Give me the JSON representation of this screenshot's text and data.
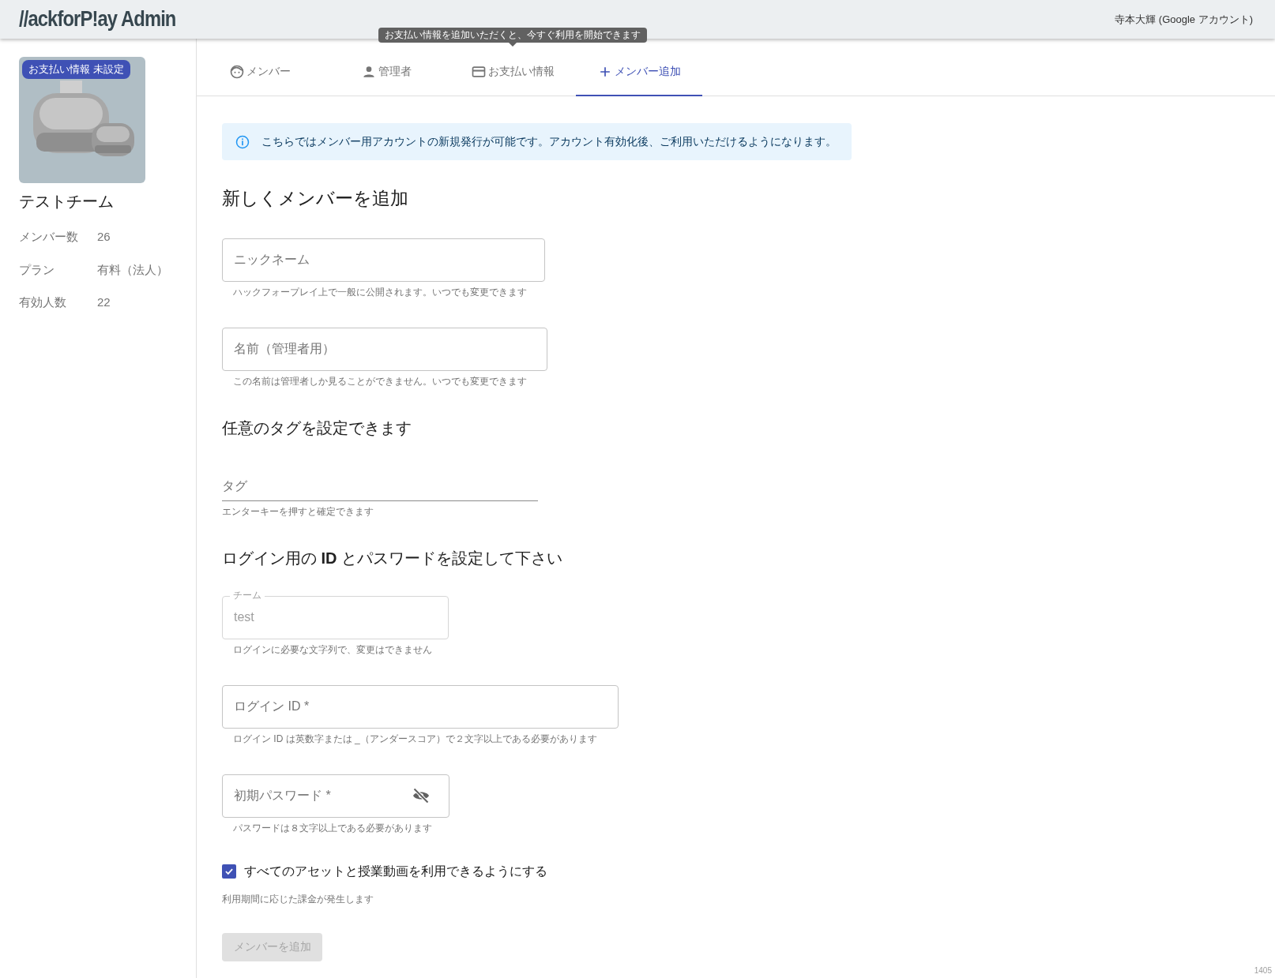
{
  "header": {
    "logo": "//ackforP!ay Admin",
    "account": "寺本大輝 (Google アカウント)"
  },
  "sidebar": {
    "badge": "お支払い情報 未設定",
    "team_name": "テストチーム",
    "stats": [
      {
        "label": "メンバー数",
        "value": "26"
      },
      {
        "label": "プラン",
        "value": "有料（法人）"
      },
      {
        "label": "有効人数",
        "value": "22"
      }
    ]
  },
  "tabs": [
    {
      "label": "メンバー",
      "selected": false
    },
    {
      "label": "管理者",
      "selected": false
    },
    {
      "label": "お支払い情報",
      "selected": false,
      "tooltip": "お支払い情報を追加いただくと、今すぐ利用を開始できます"
    },
    {
      "label": "メンバー追加",
      "selected": true
    }
  ],
  "alert": {
    "text": "こちらではメンバー用アカウントの新規発行が可能です。アカウント有効化後、ご利用いただけるようになります。"
  },
  "form": [
    {
      "kind": "heading",
      "text": "新しくメンバーを追加"
    },
    {
      "kind": "outlined",
      "placeholder": "ニックネーム",
      "helper": "ハックフォープレイ上で一般に公開されます。いつでも変更できます"
    },
    {
      "kind": "outlined",
      "placeholder": "名前（管理者用）",
      "helper": "この名前は管理者しか見ることができません。いつでも変更できます"
    },
    {
      "kind": "heading",
      "text": "任意のタグを設定できます"
    },
    {
      "kind": "underlined",
      "placeholder": "タグ",
      "helper": "エンターキーを押すと確定できます"
    },
    {
      "kind": "heading",
      "text": "ログイン用の **ID** とパスワードを設定して下さい"
    },
    {
      "kind": "outlined",
      "label": "チーム",
      "value": "test",
      "disabled": true,
      "helper": "ログインに必要な文字列で、変更はできません"
    },
    {
      "kind": "outlined",
      "placeholder": "ログイン ID *",
      "helper": "ログイン ID は英数字または _（アンダースコア）で２文字以上である必要があります"
    },
    {
      "kind": "outlined",
      "placeholder": "初期パスワード *",
      "password_visible": false,
      "helper": "パスワードは８文字以上である必要があります"
    },
    {
      "kind": "checkbox",
      "label": "すべてのアセットと授業動画を利用できるようにする",
      "checked": true
    },
    {
      "kind": "note",
      "text": "利用期間に応じた課金が発生します"
    },
    {
      "kind": "button",
      "label": "メンバーを追加",
      "disabled": true
    }
  ],
  "corner_number": "1405"
}
